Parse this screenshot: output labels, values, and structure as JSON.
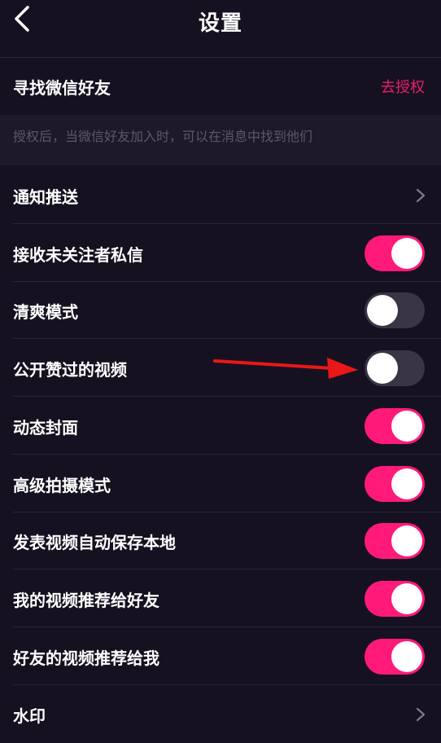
{
  "header": {
    "title": "设置"
  },
  "wechat": {
    "label": "寻找微信好友",
    "action": "去授权",
    "hint": "授权后，当微信好友加入时，可以在消息中找到他们"
  },
  "settings": {
    "notify": {
      "label": "通知推送"
    },
    "unfollowed_dm": {
      "label": "接收未关注者私信",
      "on": true
    },
    "lite_mode": {
      "label": "清爽模式",
      "on": false
    },
    "public_likes": {
      "label": "公开赞过的视频",
      "on": false
    },
    "dynamic_cover": {
      "label": "动态封面",
      "on": true
    },
    "hq_shoot": {
      "label": "高级拍摄模式",
      "on": true
    },
    "auto_save": {
      "label": "发表视频自动保存本地",
      "on": true
    },
    "recommend_my": {
      "label": "我的视频推荐给好友",
      "on": true
    },
    "recommend_friends": {
      "label": "好友的视频推荐给我",
      "on": true
    },
    "watermark": {
      "label": "水印"
    }
  },
  "colors": {
    "accent": "#ff1a7a",
    "link": "#ea1e6a",
    "background": "#161120",
    "toggle_off": "#393446"
  },
  "icons": {
    "back": "chevron-left-icon",
    "chevron": "chevron-right-icon",
    "arrow": "red-arrow-annotation"
  }
}
